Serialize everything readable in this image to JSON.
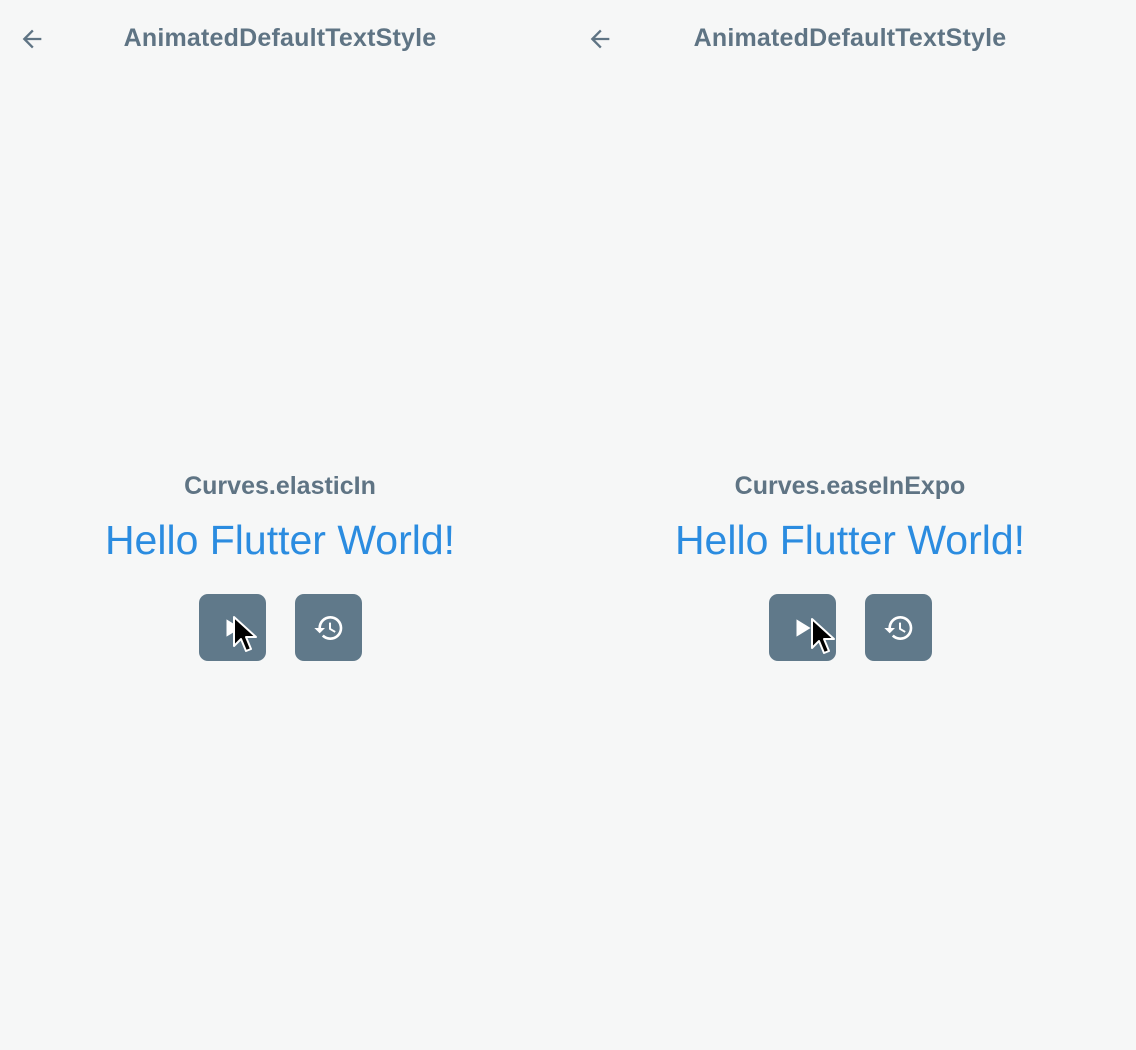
{
  "colors": {
    "background": "#f6f7f7",
    "title": "#5f7484",
    "accent_text": "#2b8ce0",
    "button_bg": "#60798a",
    "button_icon": "#ffffff"
  },
  "panes": [
    {
      "appbar": {
        "back_icon": "arrow-back-icon",
        "title": "AnimatedDefaultTextStyle"
      },
      "curve_label": "Curves.elasticIn",
      "sample_text": "Hello Flutter World!",
      "buttons": [
        {
          "name": "play",
          "icon": "play-icon"
        },
        {
          "name": "reset",
          "icon": "history-icon"
        }
      ]
    },
    {
      "appbar": {
        "back_icon": "arrow-back-icon",
        "title": "AnimatedDefaultTextStyle"
      },
      "curve_label": "Curves.easeInExpo",
      "sample_text": "Hello Flutter World!",
      "buttons": [
        {
          "name": "play",
          "icon": "play-icon"
        },
        {
          "name": "reset",
          "icon": "history-icon"
        }
      ]
    }
  ]
}
